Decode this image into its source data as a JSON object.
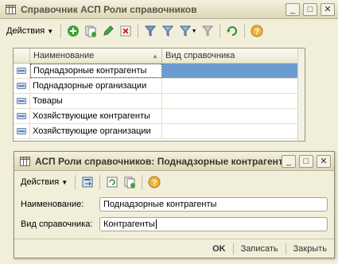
{
  "main_window": {
    "title": "Справочник АСП Роли справочников",
    "title_buttons": [
      "minimize",
      "maximize",
      "close"
    ],
    "toolbar": {
      "actions_label": "Действия",
      "icons": [
        "add-icon",
        "copy-icon",
        "edit-icon",
        "delete-icon",
        "filter-icon",
        "filter-set-icon",
        "filter-dropdown-icon",
        "filter-clear-icon",
        "refresh-icon",
        "help-icon"
      ]
    },
    "grid": {
      "columns": [
        "Наименование",
        "Вид справочника"
      ],
      "rows": [
        {
          "name": "Поднадзорные контрагенты",
          "kind": ""
        },
        {
          "name": "Поднадзорные организации",
          "kind": ""
        },
        {
          "name": "Товары",
          "kind": ""
        },
        {
          "name": "Хозяйствующие контрагенты",
          "kind": ""
        },
        {
          "name": "Хозяйствующие организации",
          "kind": ""
        }
      ],
      "selected_index": 0
    }
  },
  "form_window": {
    "title": "АСП Роли справочников: Поднадзорные контрагенты...",
    "toolbar": {
      "actions_label": "Действия"
    },
    "fields": {
      "name_label": "Наименование:",
      "name_value": "Поднадзорные контрагенты",
      "kind_label": "Вид справочника:",
      "kind_value": "Контрагенты"
    },
    "buttons": {
      "ok": "OK",
      "save": "Записать",
      "close": "Закрыть"
    }
  },
  "colors": {
    "window_bg": "#f1eeda",
    "selection": "#6b9bd1",
    "titlebar": "#dcd6b7"
  }
}
